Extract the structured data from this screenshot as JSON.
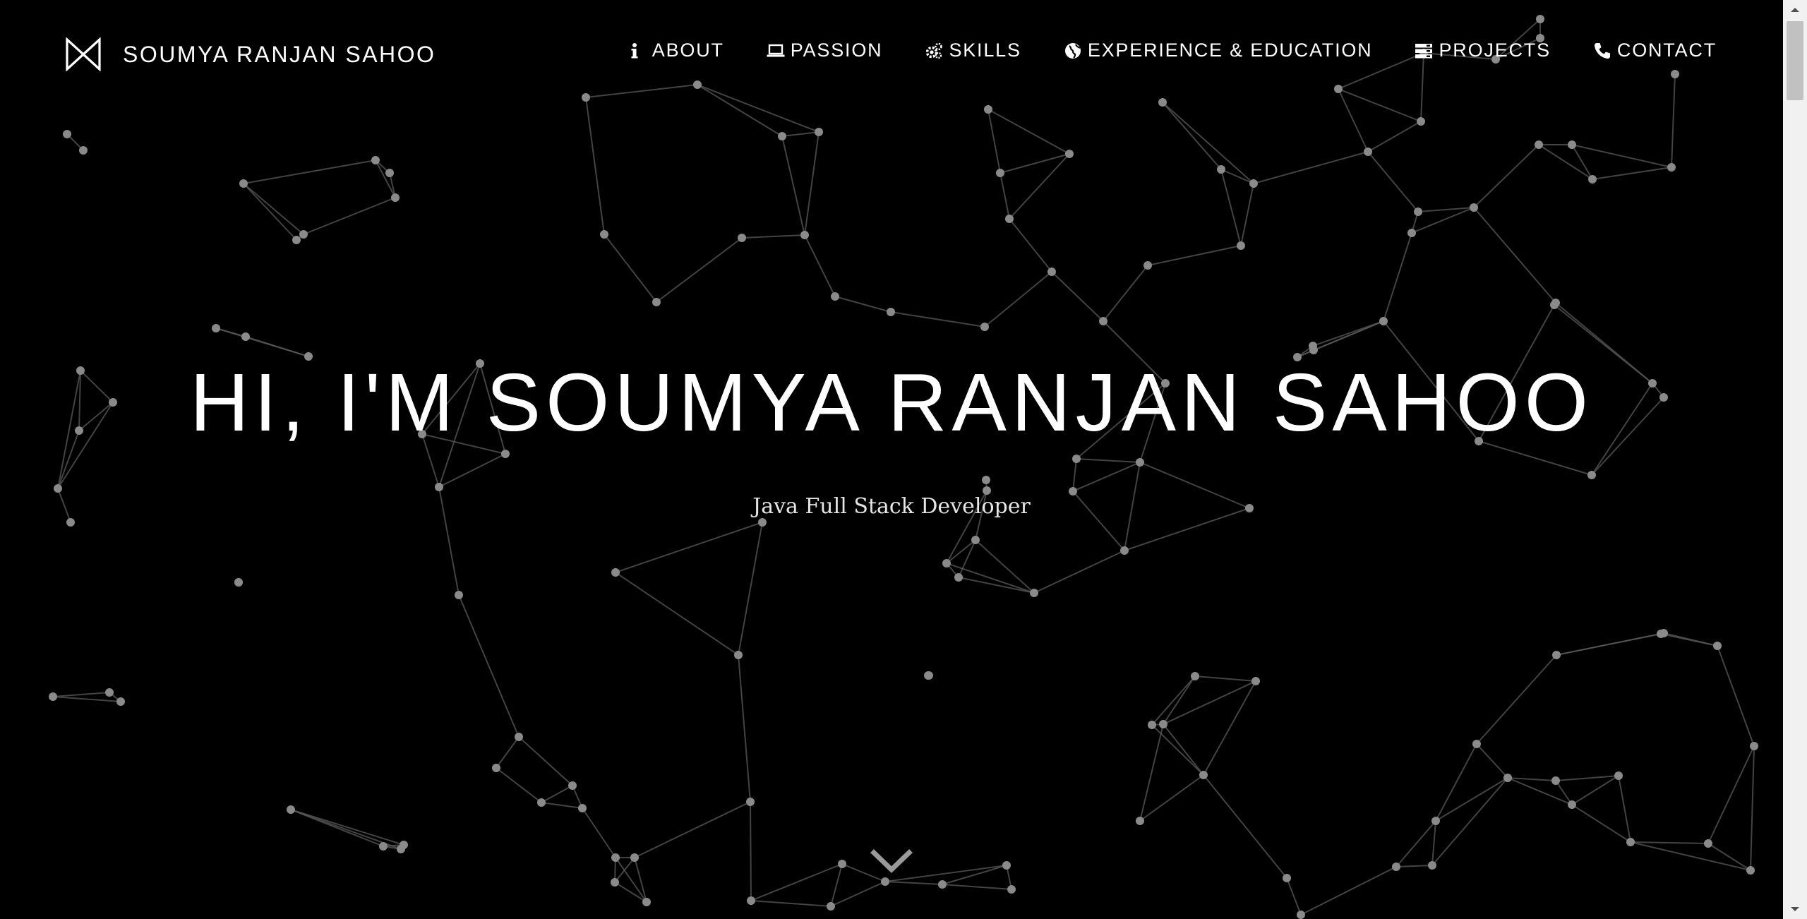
{
  "navbar": {
    "brand_name": "SOUMYA RANJAN SAHOO",
    "brand_logo_icon": "bowtie-logo-icon",
    "items": [
      {
        "label": "ABOUT",
        "icon": "info-icon"
      },
      {
        "label": "PASSION",
        "icon": "laptop-icon"
      },
      {
        "label": "SKILLS",
        "icon": "gears-icon"
      },
      {
        "label": "EXPERIENCE & EDUCATION",
        "icon": "globe-icon"
      },
      {
        "label": "PROJECTS",
        "icon": "server-icon"
      },
      {
        "label": "CONTACT",
        "icon": "phone-icon"
      }
    ]
  },
  "hero": {
    "title": "HI, I'M SOUMYA RANJAN SAHOO",
    "subtitle": "Java Full Stack Developer",
    "scroll_icon": "chevron-down-icon"
  },
  "theme": {
    "background": "#000000",
    "text": "#ffffff",
    "network_line": "#5a5a5a",
    "network_node": "#8a8a8a",
    "scrollbar_track": "#f1f1f1",
    "scrollbar_thumb": "#c1c1c1"
  }
}
